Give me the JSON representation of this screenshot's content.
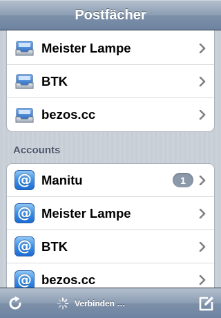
{
  "navbar": {
    "title": "Postfächer"
  },
  "mailboxes": [
    {
      "label": "Meister Lampe",
      "icon": "inbox-tray-icon"
    },
    {
      "label": "BTK",
      "icon": "inbox-tray-icon"
    },
    {
      "label": "bezos.cc",
      "icon": "inbox-tray-icon"
    }
  ],
  "accounts_header": "Accounts",
  "accounts": [
    {
      "label": "Manitu",
      "icon": "at-sign-icon",
      "badge": "1"
    },
    {
      "label": "Meister Lampe",
      "icon": "at-sign-icon"
    },
    {
      "label": "BTK",
      "icon": "at-sign-icon"
    },
    {
      "label": "bezos.cc",
      "icon": "at-sign-icon"
    }
  ],
  "at_symbol": "@",
  "toolbar": {
    "status_text": "Verbinden …",
    "refresh_icon": "refresh-icon",
    "compose_icon": "compose-icon",
    "spinner_icon": "activity-spinner-icon"
  },
  "colors": {
    "bar_gradient_top": "#b3bfcd",
    "bar_gradient_bottom": "#6d83a1",
    "badge": "#8c99ab",
    "section_header": "#4c566c",
    "background": "#c5ccd4"
  }
}
